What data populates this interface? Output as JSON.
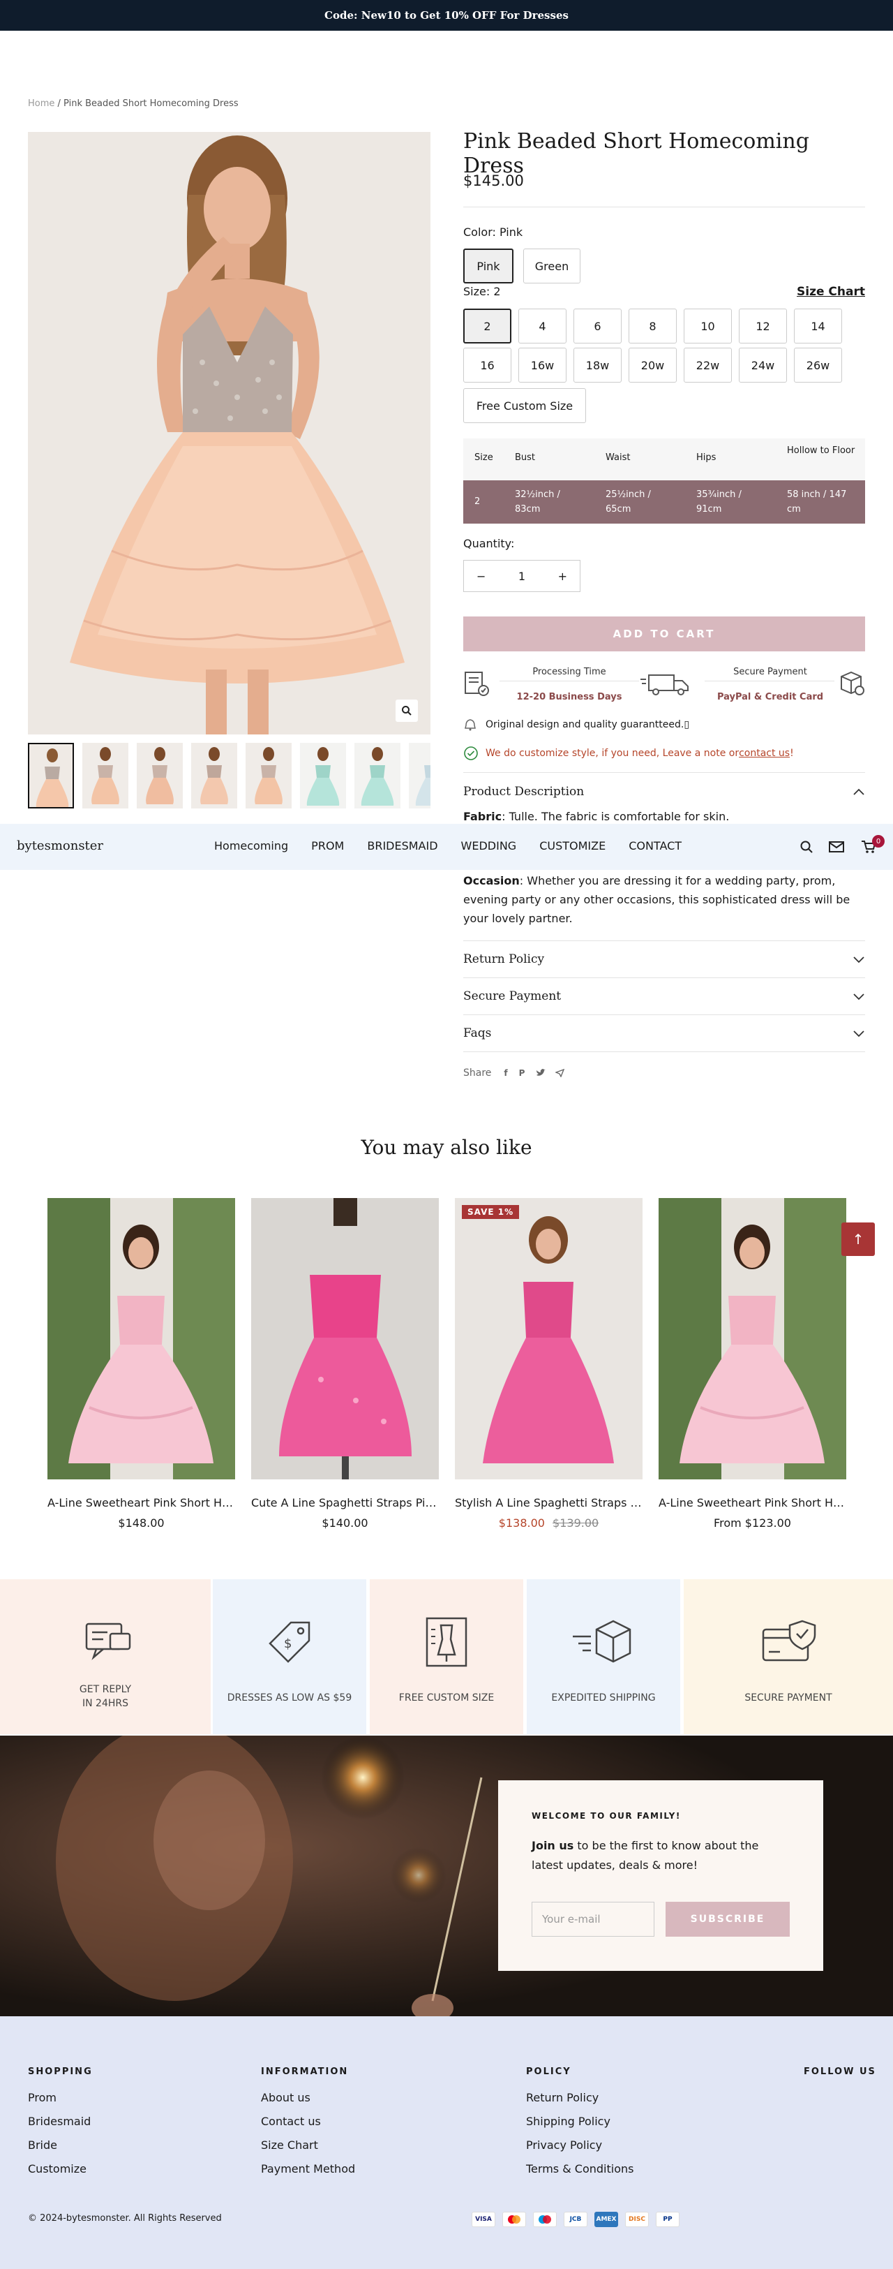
{
  "promo_bar": {
    "text": "Code: New10 to Get 10% OFF For Dresses"
  },
  "breadcrumb": {
    "home": "Home",
    "sep": " / ",
    "current": "Pink Beaded Short Homecoming Dress"
  },
  "product": {
    "title": "Pink Beaded Short Homecoming Dress",
    "price": "$145.00",
    "color_label": "Color:",
    "color_value": "Pink",
    "colors": [
      "Pink",
      "Green"
    ],
    "size_label": "Size:",
    "size_value": "2",
    "size_chart_link": "Size Chart",
    "sizes": [
      "2",
      "4",
      "6",
      "8",
      "10",
      "12",
      "14",
      "16",
      "16w",
      "18w",
      "20w",
      "22w",
      "24w",
      "26w"
    ],
    "custom_size": "Free Custom Size",
    "size_table": {
      "headers": [
        "Size",
        "Bust",
        "Waist",
        "Hips",
        "Hollow to Floor"
      ],
      "row": [
        "2",
        "32½inch / 83cm",
        "25½inch / 65cm",
        "35¾inch / 91cm",
        "58 inch / 147 cm"
      ]
    },
    "quantity_label": "Quantity:",
    "quantity": "1",
    "add_to_cart": "ADD TO CART",
    "processing_time_label": "Processing Time",
    "processing_time_value": "12-20 Business Days",
    "secure_payment_label": "Secure Payment",
    "secure_payment_value": "PayPal & Credit Card",
    "guarantee": "Original design and quality guarantteed.",
    "customize_note": "We do customize style, if you need, Leave a note or ",
    "contact_link": "contact us",
    "customize_end": "!",
    "description_title": "Product Description",
    "fabric_label": "Fabric",
    "fabric_text": ": Tulle. The fabric is comfortable for skin.",
    "occasion_label": "Occasion",
    "occasion_text": ": Whether you are dressing it for a wedding party, prom, evening party or any other occasions, this sophisticated dress will be your lovely partner.",
    "accordions": [
      "Return Policy",
      "Secure Payment",
      "Faqs"
    ],
    "share_label": "Share"
  },
  "nav": {
    "logo": "bytesmonster",
    "links": [
      "Homecoming",
      "PROM",
      "BRIDESMAID",
      "WEDDING",
      "CUSTOMIZE",
      "CONTACT"
    ],
    "cart_count": "0"
  },
  "recommend": {
    "title": "You may also like",
    "items": [
      {
        "name": "A-Line Sweetheart Pink Short Homecoming Dress",
        "price": "$148.00",
        "old": "",
        "badge": ""
      },
      {
        "name": "Cute A Line Spaghetti Straps Pink Homecoming Dress",
        "price": "$140.00",
        "old": "",
        "badge": ""
      },
      {
        "name": "Stylish A Line Spaghetti Straps Pink Homecoming Dress",
        "price": "$138.00",
        "old": "$139.00",
        "badge": "SAVE 1%"
      },
      {
        "name": "A-Line Sweetheart Pink Short Homecoming Dress",
        "price": "From $123.00",
        "old": "",
        "badge": ""
      }
    ]
  },
  "features": [
    {
      "label": "GET REPLY",
      "label2": "IN 24HRS",
      "bg": "#fcefe9"
    },
    {
      "label": "DRESSES AS LOW AS $59",
      "label2": "",
      "bg": "#edf3fb"
    },
    {
      "label": "FREE CUSTOM SIZE",
      "label2": "",
      "bg": "#fcefe9"
    },
    {
      "label": "EXPEDITED SHIPPING",
      "label2": "",
      "bg": "#edf3fb"
    },
    {
      "label": "SECURE PAYMENT",
      "label2": "",
      "bg": "#fdf5e6"
    }
  ],
  "newsletter": {
    "heading": "WELCOME TO OUR FAMILY!",
    "bold": "Join us",
    "text": " to be the first to know about the latest updates, deals & more!",
    "placeholder": "Your e-mail",
    "button": "SUBSCRIBE"
  },
  "footer": {
    "shopping_title": "SHOPPING",
    "shopping": [
      "Prom",
      "Bridesmaid",
      "Bride",
      "Customize"
    ],
    "info_title": "INFORMATION",
    "info": [
      "About us",
      "Contact us",
      "Size Chart",
      "Payment Method"
    ],
    "policy_title": "POLICY",
    "policy": [
      "Return Policy",
      "Shipping Policy",
      "Privacy Policy",
      "Terms & Conditions"
    ],
    "follow_title": "FOLLOW US",
    "copyright": "© 2024-bytesmonster. All Rights Reserved",
    "payments": [
      "VISA",
      "MC",
      "MAE",
      "JCB",
      "AMEX",
      "DISC",
      "PP"
    ]
  },
  "colors": {
    "accent": "#a83535",
    "topbar": "#0f1c2c",
    "cart_btn": "#d8b8be",
    "table_row": "#8b6b71",
    "link": "#b5452a"
  }
}
